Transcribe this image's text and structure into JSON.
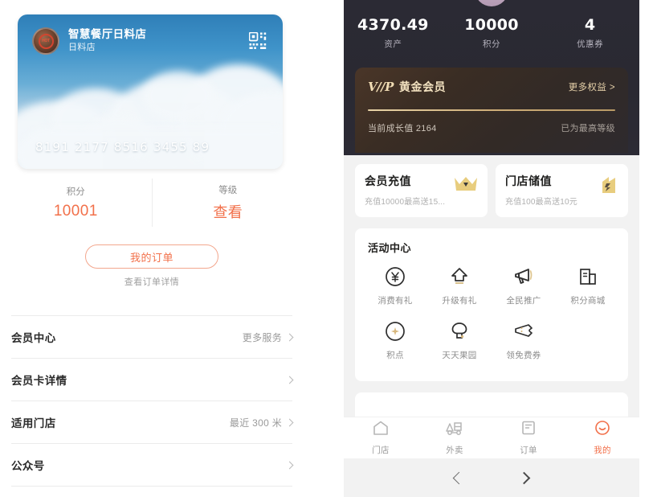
{
  "left": {
    "card": {
      "logo_text": "HOT",
      "title": "智慧餐厅日料店",
      "subtitle": "日料店",
      "number": "8191 2177 8516 3455 89",
      "qr_icon": "qr-code-icon"
    },
    "stats": [
      {
        "label": "积分",
        "value": "10001",
        "is_cn": false
      },
      {
        "label": "等级",
        "value": "查看",
        "is_cn": true
      }
    ],
    "order_button": "我的订单",
    "order_hint": "查看订单详情",
    "list": [
      {
        "title": "会员中心",
        "extra": "更多服务"
      },
      {
        "title": "会员卡详情",
        "extra": ""
      },
      {
        "title": "适用门店",
        "extra": "最近 300 米"
      },
      {
        "title": "公众号",
        "extra": ""
      }
    ]
  },
  "right": {
    "stats": [
      {
        "value": "4370.49",
        "label": "资产"
      },
      {
        "value": "10000",
        "label": "积分"
      },
      {
        "value": "4",
        "label": "优惠券"
      }
    ],
    "vip": {
      "mark": "V//P",
      "name": "黄金会员",
      "more": "更多权益 >",
      "growth": "当前成长值 2164",
      "max_level": "已为最高等级"
    },
    "recharge": [
      {
        "title": "会员充值",
        "sub": "充值10000最高送15...",
        "icon": "crown-icon"
      },
      {
        "title": "门店储值",
        "sub": "充值100最高送10元",
        "icon": "store-icon"
      }
    ],
    "activity": {
      "title": "活动中心",
      "items": [
        {
          "label": "消费有礼",
          "icon": "yen-circle-icon"
        },
        {
          "label": "升级有礼",
          "icon": "upgrade-arrow-icon"
        },
        {
          "label": "全民推广",
          "icon": "megaphone-icon"
        },
        {
          "label": "积分商城",
          "icon": "shop-icon"
        },
        {
          "label": "积点",
          "icon": "point-circle-icon"
        },
        {
          "label": "天天果园",
          "icon": "tree-icon"
        },
        {
          "label": "领免费券",
          "icon": "ticket-icon"
        }
      ]
    },
    "tabbar": [
      {
        "label": "门店",
        "icon": "home-icon",
        "active": false
      },
      {
        "label": "外卖",
        "icon": "delivery-icon",
        "active": false
      },
      {
        "label": "订单",
        "icon": "order-icon",
        "active": false
      },
      {
        "label": "我的",
        "icon": "profile-icon",
        "active": true
      }
    ],
    "sysnav": [
      {
        "icon": "nav-back-icon"
      },
      {
        "icon": "nav-forward-icon"
      }
    ]
  },
  "colors": {
    "accent": "#f2704a",
    "vip_gold": "#f3e2c0",
    "dark_bg": "#2b2a34"
  }
}
